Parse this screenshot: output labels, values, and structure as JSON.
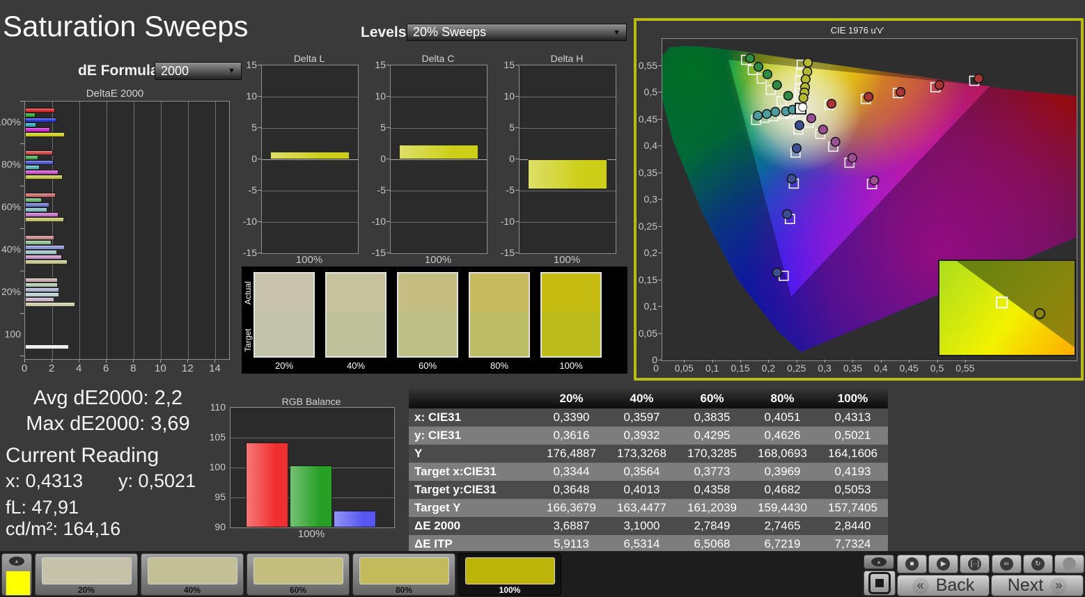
{
  "header": {
    "title": "Saturation Sweeps",
    "de_formula_label": "dE Formula:",
    "de_formula_value": "2000",
    "levels_label": "Levels:",
    "levels_value": "20% Sweeps"
  },
  "colors": {
    "accent_border": "#b9b917",
    "delta_bar_yellow": "#ccce17",
    "page_background": "#3a3a3a"
  },
  "stats": {
    "avg": "Avg dE2000: 2,2",
    "max": "Max dE2000: 3,69",
    "current_reading_label": "Current Reading",
    "x": "x: 0,4313",
    "y": "y: 0,5021",
    "fl": "fL: 47,91",
    "cdm2": "cd/m²: 164,16"
  },
  "chart_data": [
    {
      "id": "deltae2000",
      "type": "bar",
      "orientation": "horizontal",
      "title": "DeltaE 2000",
      "xlim": [
        0,
        15
      ],
      "xticks": [
        "0",
        "2",
        "4",
        "6",
        "8",
        "10",
        "12",
        "14"
      ],
      "groups": [
        {
          "label": "100%",
          "bars": [
            {
              "color": "#d62323",
              "value": 2.2
            },
            {
              "color": "#28a02c",
              "value": 0.75
            },
            {
              "color": "#2b36d8",
              "value": 2.3
            },
            {
              "color": "#2aaabc",
              "value": 0.8
            },
            {
              "color": "#ce1fce",
              "value": 1.85
            },
            {
              "color": "#cccc17",
              "value": 2.9
            }
          ]
        },
        {
          "label": "80%",
          "bars": [
            {
              "color": "#c94747",
              "value": 2.05
            },
            {
              "color": "#4aa84e",
              "value": 0.95
            },
            {
              "color": "#4a55c9",
              "value": 2.1
            },
            {
              "color": "#55b0ba",
              "value": 1.05
            },
            {
              "color": "#c94fc9",
              "value": 2.45
            },
            {
              "color": "#c2c244",
              "value": 2.75
            }
          ]
        },
        {
          "label": "60%",
          "bars": [
            {
              "color": "#c66666",
              "value": 2.25
            },
            {
              "color": "#68b06b",
              "value": 1.25
            },
            {
              "color": "#6a73c8",
              "value": 1.8
            },
            {
              "color": "#7cb9c0",
              "value": 1.65
            },
            {
              "color": "#c66fc6",
              "value": 2.45
            },
            {
              "color": "#bfbf67",
              "value": 2.85
            }
          ]
        },
        {
          "label": "40%",
          "bars": [
            {
              "color": "#c48585",
              "value": 2.15
            },
            {
              "color": "#8abd8c",
              "value": 1.95
            },
            {
              "color": "#8b92d0",
              "value": 2.9
            },
            {
              "color": "#9cc4c9",
              "value": 2.35
            },
            {
              "color": "#c491c4",
              "value": 2.7
            },
            {
              "color": "#c3c38c",
              "value": 3.1
            }
          ]
        },
        {
          "label": "20%",
          "bars": [
            {
              "color": "#c7a8a8",
              "value": 2.4
            },
            {
              "color": "#abc6ab",
              "value": 2.4
            },
            {
              "color": "#abb1d3",
              "value": 2.5
            },
            {
              "color": "#b8cfcf",
              "value": 2.5
            },
            {
              "color": "#c7adc7",
              "value": 2.15
            },
            {
              "color": "#c9c9a4",
              "value": 3.7
            }
          ]
        },
        {
          "label": "100",
          "bars": [
            {
              "color": "#ececec",
              "value": 3.2,
              "slot": 5
            }
          ]
        }
      ]
    },
    {
      "id": "delta_l",
      "type": "bar",
      "title": "Delta L",
      "categories": [
        "100%"
      ],
      "values": [
        1.2
      ],
      "ylim": [
        -15,
        15
      ],
      "yticks": [
        "15",
        "10",
        "5",
        "0",
        "-5",
        "-10",
        "-15"
      ],
      "xlabel": "100%",
      "bar_color": "#ccce17"
    },
    {
      "id": "delta_c",
      "type": "bar",
      "title": "Delta C",
      "categories": [
        "100%"
      ],
      "values": [
        2.3
      ],
      "ylim": [
        -15,
        15
      ],
      "yticks": [
        "15",
        "10",
        "5",
        "0",
        "-5",
        "-10",
        "-15"
      ],
      "xlabel": "100%",
      "bar_color": "#ccce17"
    },
    {
      "id": "delta_h",
      "type": "bar",
      "title": "Delta H",
      "categories": [
        "100%"
      ],
      "values": [
        -4.8
      ],
      "ylim": [
        -15,
        15
      ],
      "yticks": [
        "15",
        "10",
        "5",
        "0",
        "-5",
        "-10",
        "-15"
      ],
      "xlabel": "100%",
      "bar_color": "#ccce17"
    },
    {
      "id": "rgb_balance",
      "type": "bar",
      "title": "RGB Balance",
      "categories": [
        "Red",
        "Green",
        "Blue"
      ],
      "values": [
        104.2,
        100.4,
        92.8
      ],
      "colors": [
        "#f03030",
        "#28a028",
        "#5858f0"
      ],
      "ylim": [
        90,
        110
      ],
      "yticks": [
        "110",
        "105",
        "100",
        "95",
        "90"
      ],
      "xlabel": "100%"
    },
    {
      "id": "cie_diagram",
      "type": "scatter",
      "title": "CIE 1976 u'v'",
      "xlabelticks": [
        "0",
        "0,05",
        "0,1",
        "0,15",
        "0,2",
        "0,25",
        "0,3",
        "0,35",
        "0,4",
        "0,45",
        "0,5",
        "0,55"
      ],
      "ylabelticks": [
        "0,55",
        "0,5",
        "0,45",
        "0,4",
        "0,35",
        "0,3",
        "0,25",
        "0,2",
        "0,15",
        "0,1",
        "0,05",
        "0"
      ],
      "sweeps": [
        {
          "name": "red",
          "dot_color": "#a83434",
          "circles": [
            [
              0.311,
              0.479
            ],
            [
              0.377,
              0.492
            ],
            [
              0.434,
              0.501
            ],
            [
              0.503,
              0.514
            ],
            [
              0.573,
              0.526
            ]
          ],
          "squares": [
            [
              0.307,
              0.477
            ],
            [
              0.372,
              0.488
            ],
            [
              0.429,
              0.499
            ],
            [
              0.496,
              0.51
            ],
            [
              0.565,
              0.522
            ]
          ]
        },
        {
          "name": "green",
          "dot_color": "#2e8b3f",
          "circles": [
            [
              0.166,
              0.564
            ],
            [
              0.181,
              0.548
            ],
            [
              0.197,
              0.534
            ],
            [
              0.214,
              0.514
            ],
            [
              0.234,
              0.494
            ]
          ],
          "squares": [
            [
              0.159,
              0.561
            ],
            [
              0.171,
              0.542
            ],
            [
              0.187,
              0.526
            ],
            [
              0.203,
              0.505
            ],
            [
              0.222,
              0.484
            ]
          ]
        },
        {
          "name": "cyan",
          "dot_color": "#4d9d9d",
          "circles": [
            [
              0.18,
              0.457
            ],
            [
              0.196,
              0.46
            ],
            [
              0.211,
              0.464
            ],
            [
              0.23,
              0.465
            ],
            [
              0.242,
              0.468
            ]
          ],
          "squares": [
            [
              0.177,
              0.449
            ],
            [
              0.192,
              0.453
            ],
            [
              0.208,
              0.456
            ],
            [
              0.226,
              0.46
            ],
            [
              0.238,
              0.462
            ]
          ]
        },
        {
          "name": "magenta",
          "dot_color": "#9c4f93",
          "circles": [
            [
              0.275,
              0.452
            ],
            [
              0.296,
              0.431
            ],
            [
              0.318,
              0.408
            ],
            [
              0.348,
              0.378
            ],
            [
              0.387,
              0.336
            ]
          ],
          "squares": [
            [
              0.271,
              0.444
            ],
            [
              0.291,
              0.423
            ],
            [
              0.314,
              0.399
            ],
            [
              0.343,
              0.369
            ],
            [
              0.383,
              0.329
            ]
          ]
        },
        {
          "name": "blue",
          "dot_color": "#3d4f93",
          "circles": [
            [
              0.254,
              0.439
            ],
            [
              0.249,
              0.396
            ],
            [
              0.24,
              0.339
            ],
            [
              0.232,
              0.273
            ],
            [
              0.214,
              0.164
            ]
          ],
          "squares": [
            [
              0.252,
              0.431
            ],
            [
              0.247,
              0.388
            ],
            [
              0.244,
              0.33
            ],
            [
              0.237,
              0.264
            ],
            [
              0.226,
              0.158
            ]
          ]
        },
        {
          "name": "yellow",
          "dot_color": "#b5b832",
          "circles": [
            [
              0.269,
              0.556
            ],
            [
              0.268,
              0.539
            ],
            [
              0.265,
              0.525
            ],
            [
              0.264,
              0.51
            ],
            [
              0.263,
              0.5
            ],
            [
              0.261,
              0.49
            ]
          ],
          "squares": [
            [
              0.258,
              0.552
            ],
            [
              0.257,
              0.538
            ],
            [
              0.255,
              0.523
            ],
            [
              0.255,
              0.509
            ],
            [
              0.254,
              0.499
            ],
            [
              0.254,
              0.488
            ]
          ]
        }
      ],
      "white_point": {
        "u": 0.256,
        "v": 0.47
      },
      "inset": {
        "square": {
          "x": 0.46,
          "y": 0.44
        },
        "circle": {
          "x": 0.74,
          "y": 0.56
        }
      }
    },
    {
      "id": "actual_target",
      "type": "swatch-compare",
      "row_labels": [
        "Actual",
        "Target"
      ],
      "categories": [
        "20%",
        "40%",
        "60%",
        "80%",
        "100%"
      ],
      "actual": [
        "#c9c3ae",
        "#c7c29c",
        "#c5bd82",
        "#c7ba5e",
        "#c6bb10"
      ],
      "target": [
        "#c2c2aa",
        "#bfc19a",
        "#bcbf86",
        "#bcbd64",
        "#bcbd1c"
      ]
    }
  ],
  "table": {
    "columns": [
      "",
      "20%",
      "40%",
      "60%",
      "80%",
      "100%"
    ],
    "rows": [
      {
        "label": "x: CIE31",
        "values": [
          "0,3390",
          "0,3597",
          "0,3835",
          "0,4051",
          "0,4313"
        ]
      },
      {
        "label": "y: CIE31",
        "values": [
          "0,3616",
          "0,3932",
          "0,4295",
          "0,4626",
          "0,5021"
        ]
      },
      {
        "label": "Y",
        "values": [
          "176,4887",
          "173,3268",
          "170,3285",
          "168,0693",
          "164,1606"
        ]
      },
      {
        "label": "Target x:CIE31",
        "values": [
          "0,3344",
          "0,3564",
          "0,3773",
          "0,3969",
          "0,4193"
        ]
      },
      {
        "label": "Target y:CIE31",
        "values": [
          "0,3648",
          "0,4013",
          "0,4358",
          "0,4682",
          "0,5053"
        ]
      },
      {
        "label": "Target Y",
        "values": [
          "166,3679",
          "163,4477",
          "161,2039",
          "159,4430",
          "157,7405"
        ]
      },
      {
        "label": "ΔE 2000",
        "values": [
          "3,6887",
          "3,1000",
          "2,7849",
          "2,7465",
          "2,8440"
        ]
      },
      {
        "label": "ΔE ITP",
        "values": [
          "5,9113",
          "6,5314",
          "6,5068",
          "6,7219",
          "7,7324"
        ]
      }
    ]
  },
  "bottom_bar": {
    "current_color": "#ffff00",
    "swatches": [
      {
        "label": "20%",
        "color": "#c6c1a9",
        "selected": false
      },
      {
        "label": "40%",
        "color": "#c4c096",
        "selected": false
      },
      {
        "label": "60%",
        "color": "#c3bd7e",
        "selected": false
      },
      {
        "label": "80%",
        "color": "#c2ba5b",
        "selected": false
      },
      {
        "label": "100%",
        "color": "#bdb409",
        "selected": true
      }
    ],
    "icons": {
      "up": "▲",
      "stop": "■",
      "play": "▶",
      "pattern": "[··]",
      "infinity": "∞",
      "refresh": "↻"
    },
    "back_label": "Back",
    "next_label": "Next",
    "back_chevron": "«",
    "next_chevron": "»"
  }
}
